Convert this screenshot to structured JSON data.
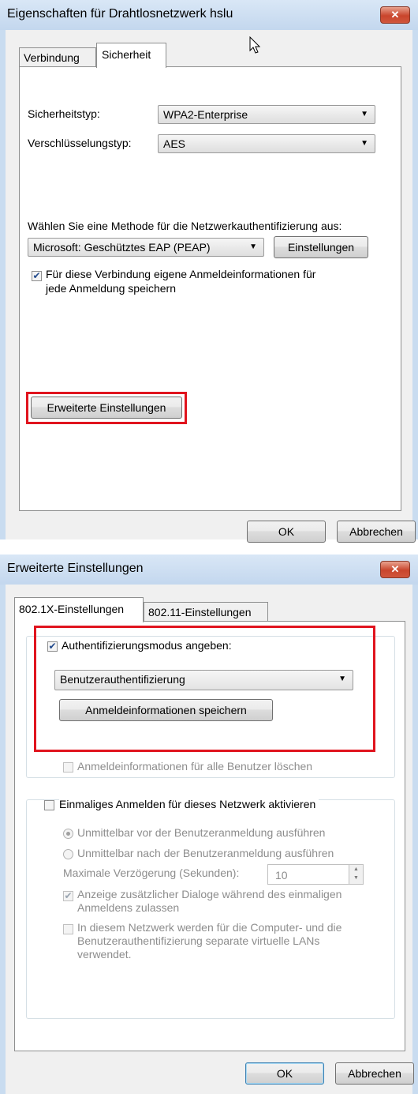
{
  "dialog1": {
    "title": "Eigenschaften für Drahtlosnetzwerk hslu",
    "close_glyph": "✕",
    "tabs": [
      "Verbindung",
      "Sicherheit"
    ],
    "active_tab": "Sicherheit",
    "security_type_label": "Sicherheitstyp:",
    "security_type_value": "WPA2-Enterprise",
    "encryption_type_label": "Verschlüsselungstyp:",
    "encryption_type_value": "AES",
    "auth_method_label": "Wählen Sie eine Methode für die Netzwerkauthentifizierung aus:",
    "auth_method_value": "Microsoft: Geschütztes EAP (PEAP)",
    "settings_button": "Einstellungen",
    "remember_credentials_checked": true,
    "remember_credentials_line1": "Für diese Verbindung eigene Anmeldeinformationen für",
    "remember_credentials_line2": "jede Anmeldung speichern",
    "advanced_button": "Erweiterte Einstellungen",
    "ok_button": "OK",
    "cancel_button": "Abbrechen"
  },
  "dialog2": {
    "title": "Erweiterte Einstellungen",
    "close_glyph": "✕",
    "tabs": [
      "802.1X-Einstellungen",
      "802.11-Einstellungen"
    ],
    "active_tab": "802.1X-Einstellungen",
    "specify_auth_mode_checked": true,
    "specify_auth_mode_label": "Authentifizierungsmodus angeben:",
    "auth_mode_value": "Benutzerauthentifizierung",
    "save_credentials_button": "Anmeldeinformationen speichern",
    "delete_credentials_label": "Anmeldeinformationen für alle Benutzer löschen",
    "sso_checked": false,
    "sso_label": "Einmaliges Anmelden für dieses Netzwerk aktivieren",
    "radio_before_label": "Unmittelbar vor der Benutzeranmeldung ausführen",
    "radio_after_label": "Unmittelbar nach der Benutzeranmeldung ausführen",
    "max_delay_label": "Maximale Verzögerung (Sekunden):",
    "max_delay_value": "10",
    "additional_dialogs_label_line1": "Anzeige zusätzlicher Dialoge während des einmaligen",
    "additional_dialogs_label_line2": "Anmeldens zulassen",
    "separate_vlan_line1": "In diesem Netzwerk werden für die Computer- und die",
    "separate_vlan_line2": "Benutzerauthentifizierung separate virtuelle LANs",
    "separate_vlan_line3": "verwendet.",
    "ok_button": "OK",
    "cancel_button": "Abbrechen"
  },
  "colors": {
    "highlight_red": "#e0141e",
    "title_bar_blue": "#c9dcf0",
    "close_red": "#c9452c"
  }
}
